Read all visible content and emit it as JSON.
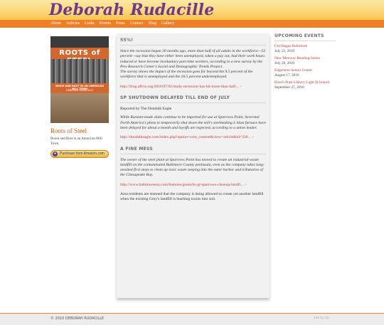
{
  "site": {
    "title": "Deborah Rudacille"
  },
  "nav": {
    "items": [
      {
        "label": "About"
      },
      {
        "label": "Articles"
      },
      {
        "label": "Links"
      },
      {
        "label": "Events"
      },
      {
        "label": "Press"
      },
      {
        "label": "Contact"
      },
      {
        "label": "Blog"
      },
      {
        "label": "Gallery"
      }
    ]
  },
  "book": {
    "cover_title": "ROOTS of STEEL",
    "cover_subtitle": "BOOM AND BUST IN AN AMERICAN MILL TOWN",
    "cover_author": "DEBORAH RUDACILLE",
    "title": "Roots of Steel",
    "subtitle": "Boom and Bust in an American Mill Town",
    "buy_label": "Purchase from Amazon.com"
  },
  "posts": [
    {
      "title": "55%!",
      "body": "Since the recession began 30 months ago, more than half of all adults in the workforce—55 percent—say that they have either been unemployed, taken a pay cut, had their work hours reduced or have become involuntary part-time workers, according to a new survey by the Pew Research Center's Social and Demographic Trends Project.",
      "body2": "The survey shows the impact of the recession goes far beyond the 9.5 percent of the workforce that is unemployed and the 16.5 percent underemployed.",
      "link": "http://blog.aflcio.org/2010/07/02/study-recession-has-hit-more-than-half..."
    },
    {
      "title": "SP SHUTDOWN DELAYED TILL END OF JULY",
      "byline": "Reported by The Dundalk Eagle",
      "body": "While Russian-made slabs continue to be imported for use at Sparrows Point, Severstal North America's plans to temporarily shut down the mill's steelmaking L blast furnace have been delayed for about a month and layoffs are expected, according to a union leader.",
      "link": "http://dundalkeagle.com/index.php?option=com_content&view=article&id=330..."
    },
    {
      "title": "A FINE MESS",
      "body": "The owner of the steel plant at Sparrows Point has moved to create an industrial-waste landfill on the contaminated Baltimore County peninsula, even as the company takes long-awaited first steps to clean up toxic waste seeping into the outer harbor and tributaries of the Chesapeake Bay.",
      "link": "http://www.baltimoresun.com/features/green/bs-gr-sparrows-cleanup-landfi...",
      "after": "Area residents are stunned that the company is being allowed to create yet another landfill when the existing Grey's landfill is leaching toxins into soil."
    }
  ],
  "sidebar": {
    "title": "UPCOMING EVENTS",
    "events": [
      {
        "name": "CityStages Baltimore",
        "date": "July 22, 2010"
      },
      {
        "name": "New Mercury Reading Series",
        "date": "July 28, 2010"
      },
      {
        "name": "Edgemere Senior Center",
        "date": "August 17, 2010"
      },
      {
        "name": "Enoch Pratt Library Light St branch",
        "date": "September 27, 2010"
      }
    ]
  },
  "footer": {
    "copyright": "© 2010 DEBORAH RUDACILLE",
    "credit": "site by kp"
  }
}
